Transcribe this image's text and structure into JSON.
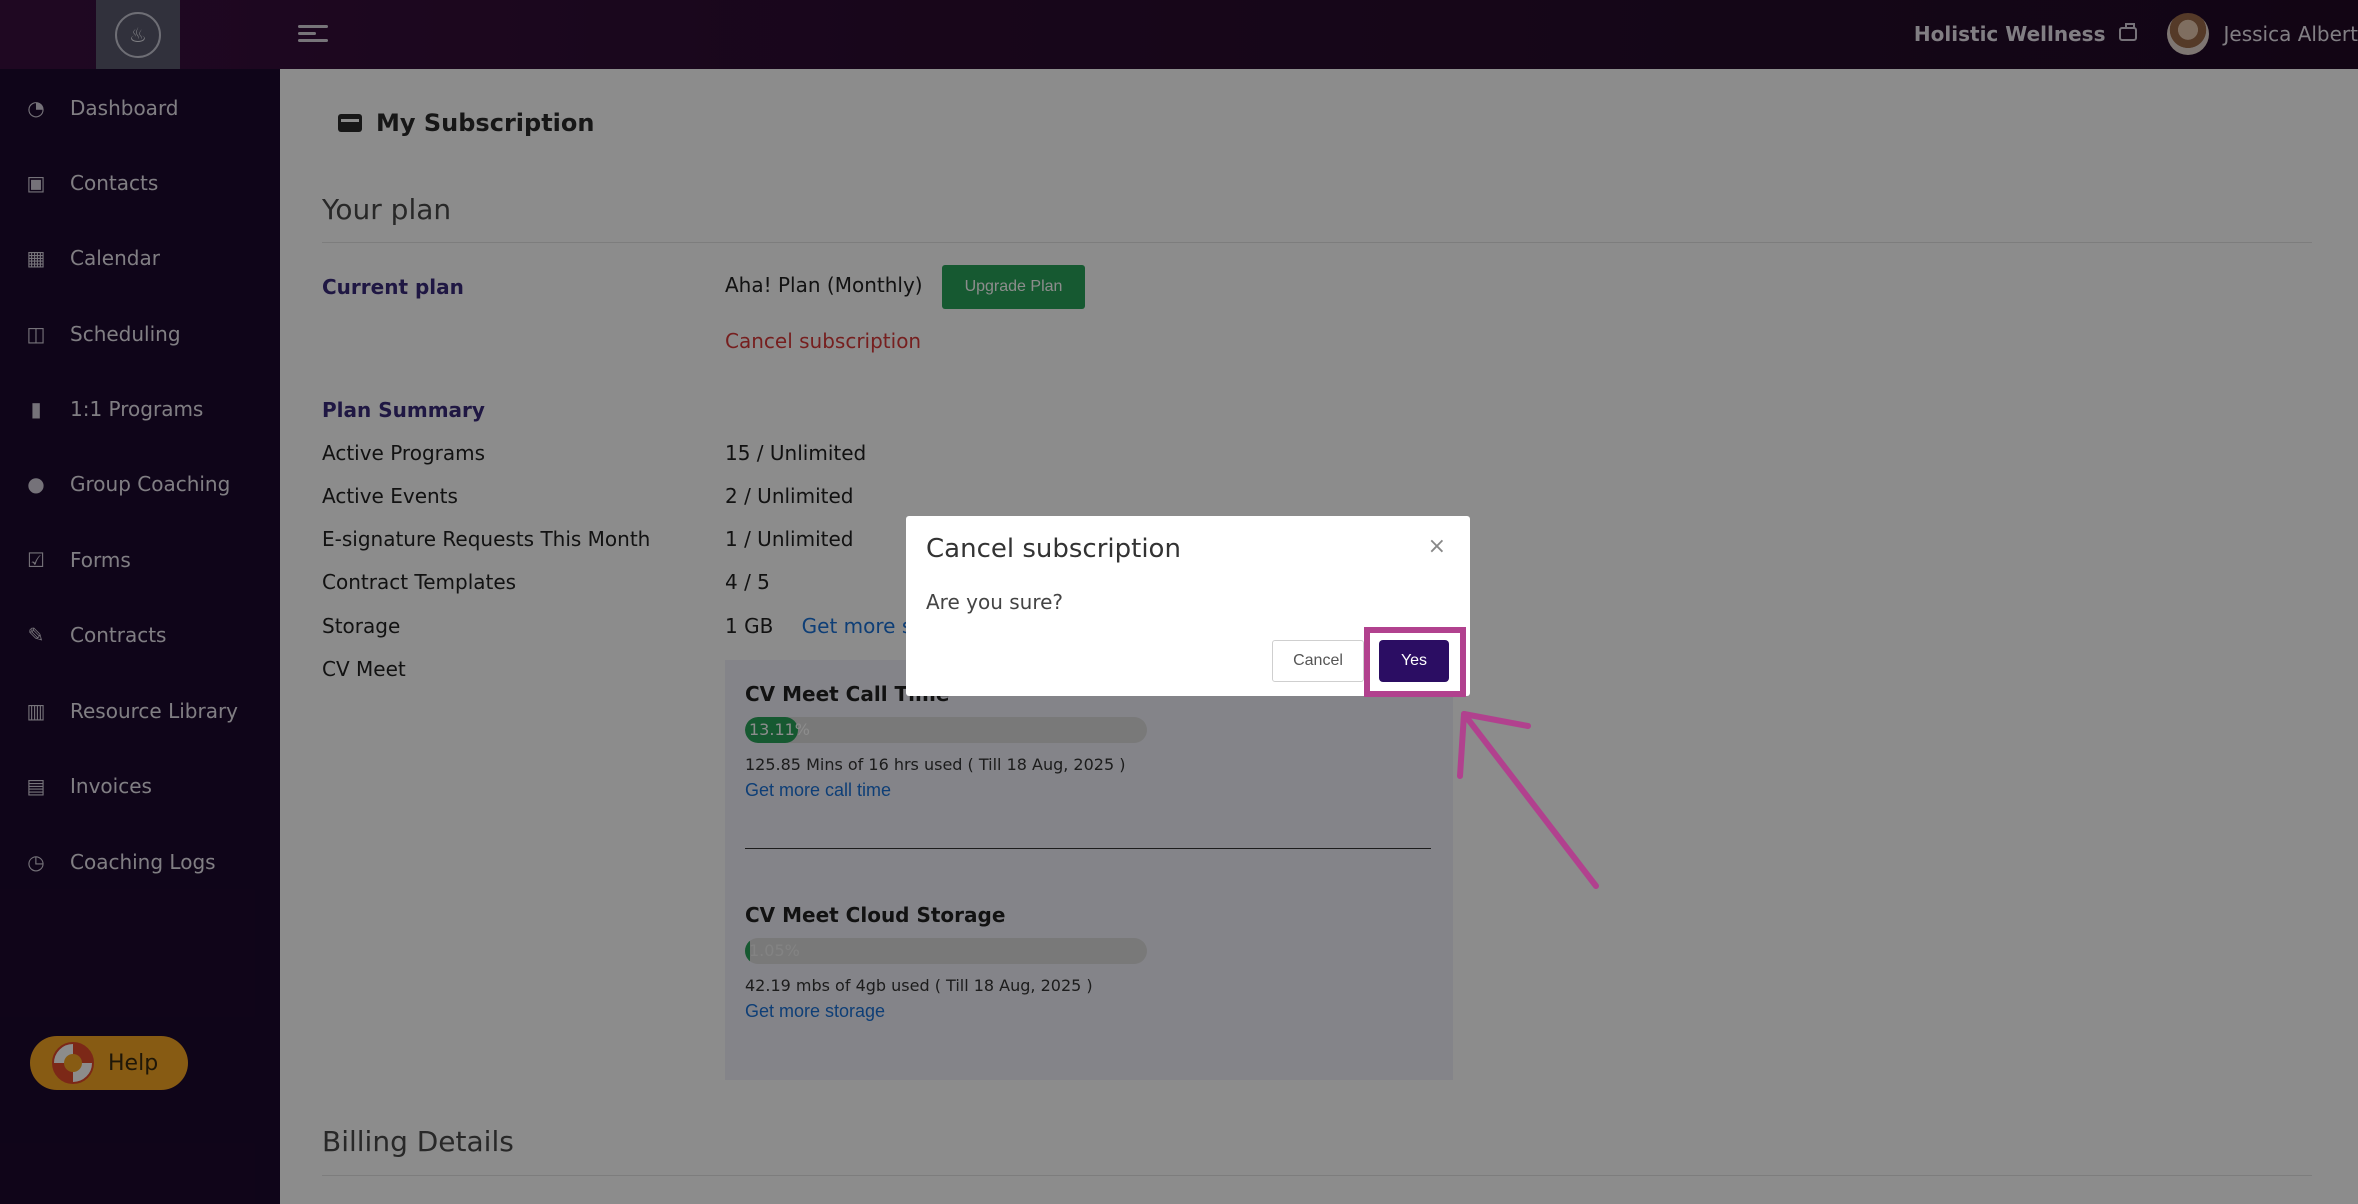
{
  "topbar": {
    "business_name": "Holistic Wellness",
    "user_name": "Jessica Albert"
  },
  "sidebar": {
    "items": [
      {
        "label": "Dashboard",
        "icon": "dashboard-icon"
      },
      {
        "label": "Contacts",
        "icon": "contacts-icon"
      },
      {
        "label": "Calendar",
        "icon": "calendar-icon"
      },
      {
        "label": "Scheduling",
        "icon": "scheduling-icon"
      },
      {
        "label": "1:1 Programs",
        "icon": "book-icon"
      },
      {
        "label": "Group Coaching",
        "icon": "group-icon"
      },
      {
        "label": "Forms",
        "icon": "checklist-icon"
      },
      {
        "label": "Contracts",
        "icon": "contract-sign-icon"
      },
      {
        "label": "Resource Library",
        "icon": "library-icon"
      },
      {
        "label": "Invoices",
        "icon": "invoice-icon"
      },
      {
        "label": "Coaching Logs",
        "icon": "clock-icon"
      }
    ],
    "help_label": "Help"
  },
  "main": {
    "page_title": "My Subscription",
    "your_plan_title": "Your plan",
    "current_plan_label": "Current plan",
    "current_plan_value": "Aha! Plan (Monthly)",
    "upgrade_label": "Upgrade Plan",
    "cancel_subscription_link": "Cancel subscription",
    "plan_summary_label": "Plan Summary",
    "summary": [
      {
        "label": "Active Programs",
        "value": "15 / Unlimited"
      },
      {
        "label": "Active Events",
        "value": "2 / Unlimited"
      },
      {
        "label": "E-signature Requests This Month",
        "value": "1 / Unlimited"
      },
      {
        "label": "Contract Templates",
        "value": "4 / 5"
      },
      {
        "label": "Storage",
        "value": "1 GB",
        "link": "Get more s"
      },
      {
        "label": "CV Meet",
        "value": ""
      }
    ],
    "cv_meet": {
      "call_time_title": "CV Meet Call Time",
      "call_time_percent": "13.11%",
      "call_time_fraction": 0.1311,
      "call_time_meta": "125.85 Mins of 16 hrs used ( Till 18 Aug, 2025 )",
      "call_time_link": "Get more call time",
      "storage_title": "CV Meet Cloud Storage",
      "storage_percent": "1.05%",
      "storage_fraction": 0.0105,
      "storage_meta": "42.19 mbs of 4gb used ( Till 18 Aug, 2025 )",
      "storage_link": "Get more storage"
    },
    "billing_title": "Billing Details"
  },
  "modal": {
    "title": "Cancel subscription",
    "close_glyph": "×",
    "body": "Are you sure?",
    "cancel_label": "Cancel",
    "yes_label": "Yes"
  },
  "colors": {
    "sidebar_bg": "#1d0a2e",
    "topbar_bg": "#2c0c31",
    "accent": "#2b0d63",
    "upgrade_green": "#29a35a",
    "danger_red": "#d83a3a",
    "highlight": "#b1418e",
    "help_orange": "#f6a623"
  }
}
